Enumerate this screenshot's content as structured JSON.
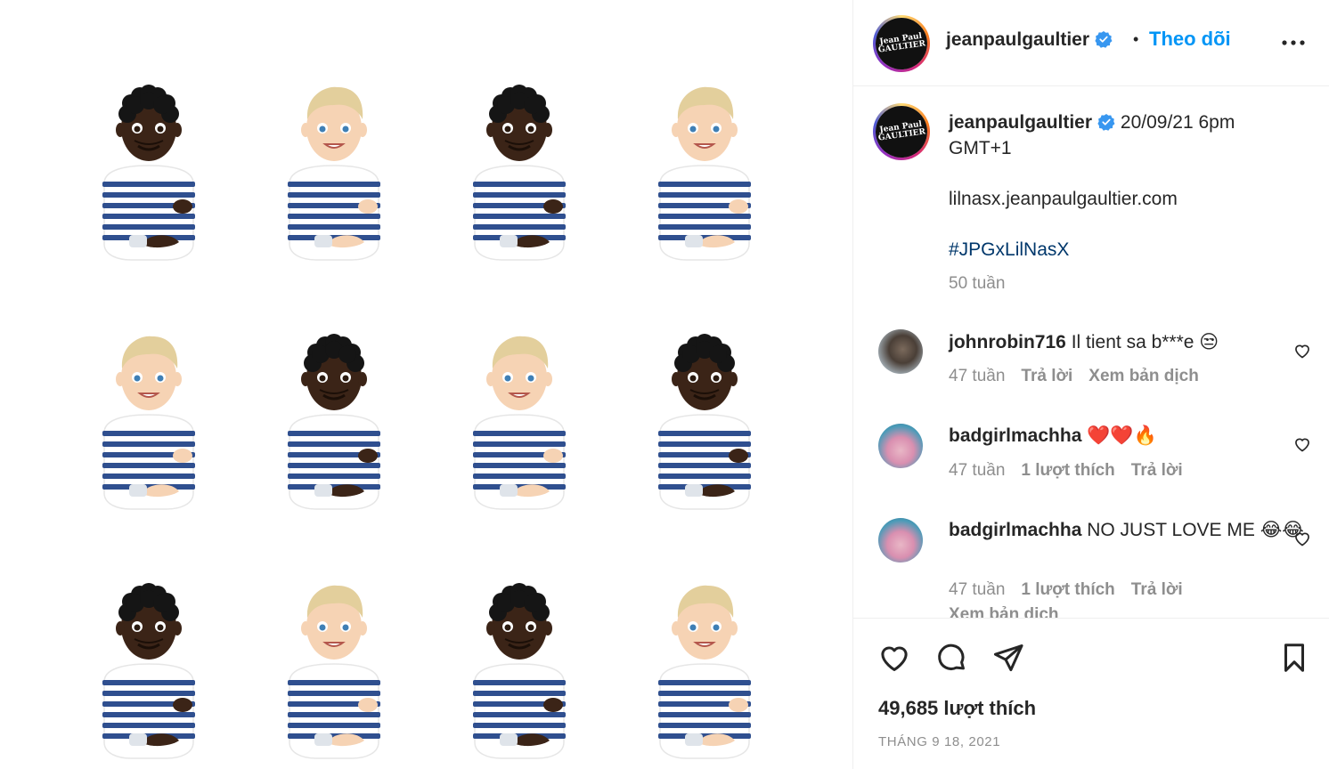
{
  "post": {
    "username": "jeanpaulgaultier",
    "follow_label": "Theo dõi",
    "separator": "•",
    "avatar_text_1": "Jean Paul",
    "avatar_text_2": "GAULTIER"
  },
  "caption": {
    "username": "jeanpaulgaultier",
    "text_line1": "20/09/21 6pm",
    "text_line2": "GMT+1",
    "link": "lilnasx.jeanpaulgaultier.com",
    "hashtag": "#JPGxLilNasX",
    "age": "50 tuần"
  },
  "comments": [
    {
      "username": "johnrobin716",
      "text": "Il tient sa b***e 😒",
      "age": "47 tuần",
      "likes": "",
      "reply": "Trả lời",
      "translate": "Xem bản dịch"
    },
    {
      "username": "badgirlmachha",
      "text": "❤️❤️🔥",
      "age": "47 tuần",
      "likes": "1 lượt thích",
      "reply": "Trả lời",
      "translate": ""
    },
    {
      "username": "badgirlmachha",
      "text": "NO JUST LOVE ME 😂😂",
      "age": "47 tuần",
      "likes": "1 lượt thích",
      "reply": "Trả lời",
      "translate": "Xem bản dịch"
    }
  ],
  "footer": {
    "likes": "49,685 lượt thích",
    "date": "THÁNG 9 18, 2021"
  },
  "media": {
    "emoji_grid": [
      [
        "dark",
        "light",
        "dark",
        "light"
      ],
      [
        "light",
        "dark",
        "light",
        "dark"
      ],
      [
        "dark",
        "light",
        "dark",
        "light"
      ]
    ]
  },
  "colors": {
    "follow": "#0095f6",
    "verified": "#3897f0",
    "hashtag": "#00376b",
    "muted": "#8e8e8e",
    "stripe": "#2f4f8f",
    "dark_skin": "#3b2417",
    "light_skin": "#f6d3b4",
    "blond_hair": "#e3cf9c"
  }
}
